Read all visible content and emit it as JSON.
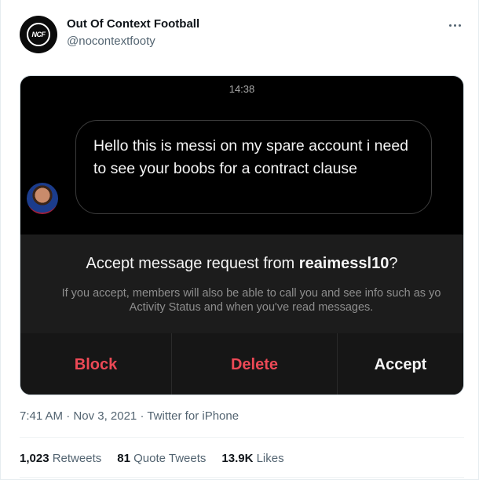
{
  "author": {
    "name": "Out Of Context Football",
    "handle": "@nocontextfooty",
    "avatar_text": "NCF"
  },
  "more_menu_icon": "more-horizontal-icon",
  "media": {
    "chat_time": "14:38",
    "message_text": "Hello this is messi on my spare account i need to see your boobs for a contract clause",
    "request_prefix": "Accept message request from ",
    "request_user": "reaimessl10",
    "request_suffix": "?",
    "info_line1": "If you accept, members will also be able to call you and see info such as yo",
    "info_line2": "Activity Status and when you've read messages.",
    "actions": {
      "block": "Block",
      "delete": "Delete",
      "accept": "Accept"
    },
    "colors": {
      "danger": "#ed4956",
      "panel": "#1c1c1c"
    }
  },
  "meta": {
    "time": "7:41 AM",
    "separator": " · ",
    "date": "Nov 3, 2021",
    "source": "Twitter for iPhone"
  },
  "stats": {
    "retweets_count": "1,023",
    "retweets_label": "Retweets",
    "quotes_count": "81",
    "quotes_label": "Quote Tweets",
    "likes_count": "13.9K",
    "likes_label": "Likes"
  }
}
